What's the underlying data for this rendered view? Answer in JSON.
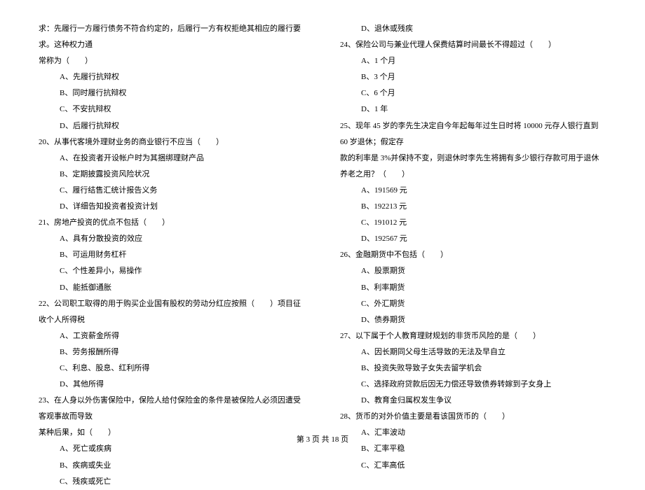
{
  "left_column": {
    "lines": [
      {
        "type": "question",
        "text": "求：先履行一方履行债务不符合约定的，后履行一方有权拒绝其相应的履行要求。这种权力通"
      },
      {
        "type": "question",
        "text": "常称为（　　）"
      },
      {
        "type": "option",
        "text": "A、先履行抗辩权"
      },
      {
        "type": "option",
        "text": "B、同时履行抗辩权"
      },
      {
        "type": "option",
        "text": "C、不安抗辩权"
      },
      {
        "type": "option",
        "text": "D、后履行抗辩权"
      },
      {
        "type": "question",
        "text": "20、从事代客境外理财业务的商业银行不应当（　　）"
      },
      {
        "type": "option",
        "text": "A、在投资者开设帐户时为其捆绑理财产品"
      },
      {
        "type": "option",
        "text": "B、定期披露投资风险状况"
      },
      {
        "type": "option",
        "text": "C、履行结售汇统计报告义务"
      },
      {
        "type": "option",
        "text": "D、详细告知投资者投资计划"
      },
      {
        "type": "question",
        "text": "21、房地产投资的优点不包括（　　）"
      },
      {
        "type": "option",
        "text": "A、具有分散投资的效应"
      },
      {
        "type": "option",
        "text": "B、可运用财务杠杆"
      },
      {
        "type": "option",
        "text": "C、个性差异小，易操作"
      },
      {
        "type": "option",
        "text": "D、能抵御通胀"
      },
      {
        "type": "question",
        "text": "22、公司职工取得的用于购买企业国有股权的劳动分红应按照（　　）项目征收个人所得税"
      },
      {
        "type": "option",
        "text": "A、工资薪金所得"
      },
      {
        "type": "option",
        "text": "B、劳务报酬所得"
      },
      {
        "type": "option",
        "text": "C、利息、股息、红利所得"
      },
      {
        "type": "option",
        "text": "D、其他所得"
      },
      {
        "type": "question",
        "text": "23、在人身以外伤害保险中，保险人给付保险金的条件是被保险人必须因遭受客观事故而导致"
      },
      {
        "type": "question",
        "text": "某种后果，如（　　）"
      },
      {
        "type": "option",
        "text": "A、死亡或疾病"
      },
      {
        "type": "option",
        "text": "B、疾病或失业"
      },
      {
        "type": "option",
        "text": "C、残疾或死亡"
      }
    ]
  },
  "right_column": {
    "lines": [
      {
        "type": "option",
        "text": "D、退休或残疾"
      },
      {
        "type": "question",
        "text": "24、保险公司与兼业代理人保费结算时间最长不得超过（　　）"
      },
      {
        "type": "option",
        "text": "A、1 个月"
      },
      {
        "type": "option",
        "text": "B、3 个月"
      },
      {
        "type": "option",
        "text": "C、6 个月"
      },
      {
        "type": "option",
        "text": "D、1 年"
      },
      {
        "type": "question",
        "text": "25、现年 45 岁的李先生决定自今年起每年过生日时将 10000 元存人银行直到 60 岁退休；假定存"
      },
      {
        "type": "question",
        "text": "款的利率是 3%并保持不变，则退休时李先生将拥有多少银行存款可用于退休养老之用？（　　）"
      },
      {
        "type": "option",
        "text": "A、191569 元"
      },
      {
        "type": "option",
        "text": "B、192213 元"
      },
      {
        "type": "option",
        "text": "C、191012 元"
      },
      {
        "type": "option",
        "text": "D、192567 元"
      },
      {
        "type": "question",
        "text": "26、金融期货中不包括（　　）"
      },
      {
        "type": "option",
        "text": "A、股票期货"
      },
      {
        "type": "option",
        "text": "B、利率期货"
      },
      {
        "type": "option",
        "text": "C、外汇期货"
      },
      {
        "type": "option",
        "text": "D、债券期货"
      },
      {
        "type": "question",
        "text": "27、以下属于个人教育理财规划的非货币风险的是（　　）"
      },
      {
        "type": "option",
        "text": "A、因长期同父母生活导致的无法及早自立"
      },
      {
        "type": "option",
        "text": "B、投资失败导致子女失去留学机会"
      },
      {
        "type": "option",
        "text": "C、选择政府贷款后因无力偿还导致债券转嫁到子女身上"
      },
      {
        "type": "option",
        "text": "D、教育金归属权发生争议"
      },
      {
        "type": "question",
        "text": "28、货币的对外价值主要是看该国货币的（　　）"
      },
      {
        "type": "option",
        "text": "A、汇率波动"
      },
      {
        "type": "option",
        "text": "B、汇率平稳"
      },
      {
        "type": "option",
        "text": "C、汇率高低"
      }
    ]
  },
  "footer": {
    "text": "第 3 页 共 18 页"
  }
}
